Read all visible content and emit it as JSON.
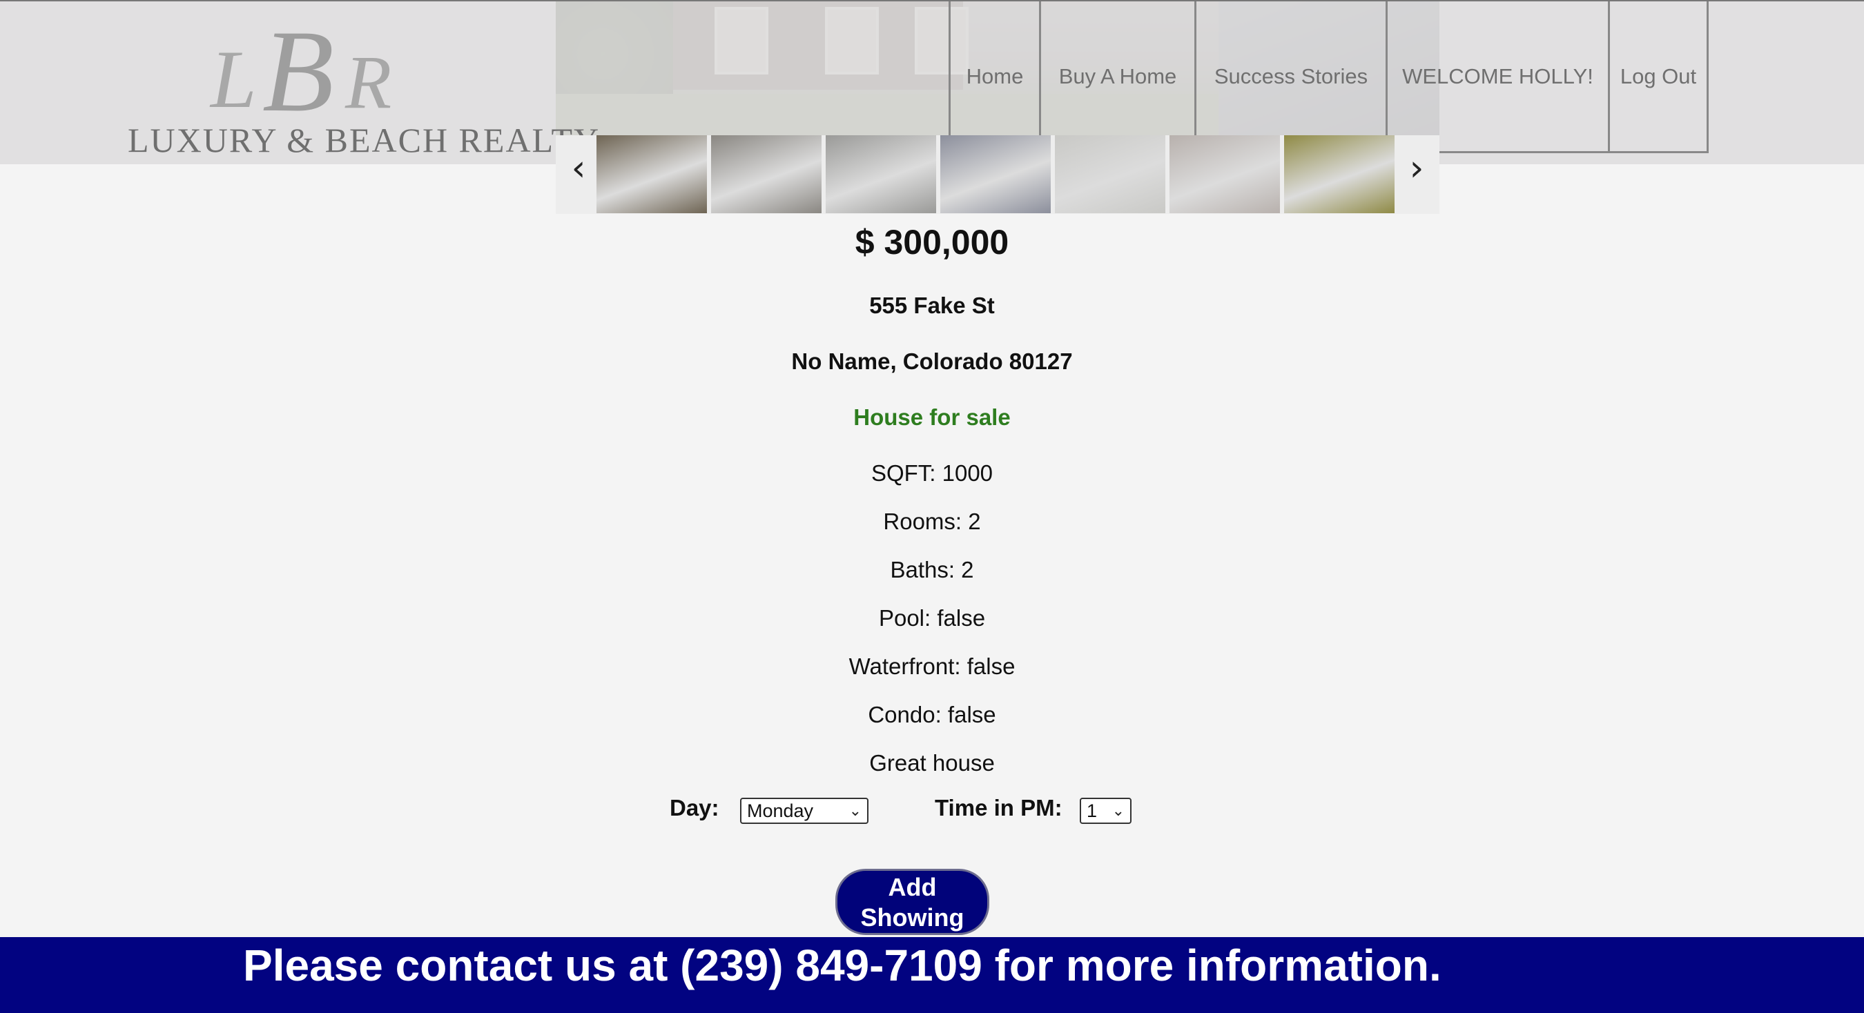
{
  "brand": {
    "monogram_l": "L",
    "monogram_b": "B",
    "monogram_r": "R",
    "name": "LUXURY & BEACH REALTY"
  },
  "nav": {
    "home": "Home",
    "buy_a_home": "Buy A Home",
    "success_stories": "Success Stories",
    "welcome": "WELCOME HOLLY!",
    "log_out": "Log Out"
  },
  "gallery": {
    "prev_icon": "chevron-left-icon",
    "next_icon": "chevron-right-icon",
    "prev_glyph": "‹",
    "next_glyph": "›",
    "thumbnail_colors": [
      "#6e6453",
      "#8a8782",
      "#9a9a98",
      "#8c8f9c",
      "#c9c9c6",
      "#b8b1ad",
      "#8f8a45"
    ]
  },
  "listing": {
    "price": "$ 300,000",
    "street": "555 Fake St",
    "city_state_zip": "No Name, Colorado 80127",
    "status": "House for sale",
    "sqft": "SQFT: 1000",
    "rooms": "Rooms: 2",
    "baths": "Baths: 2",
    "pool": "Pool: false",
    "waterfront": "Waterfront: false",
    "condo": "Condo: false",
    "description": "Great house"
  },
  "showing_form": {
    "day_label": "Day:",
    "day_value": "Monday",
    "time_label": "Time in PM:",
    "time_value": "1",
    "add_line1": "Add",
    "add_line2": "Showing"
  },
  "footer": {
    "message": "Please contact us at (239) 849-7109 for more information."
  },
  "colors": {
    "status_green": "#2e7d1f",
    "footer_navy": "#020381",
    "button_navy": "#01037a"
  }
}
